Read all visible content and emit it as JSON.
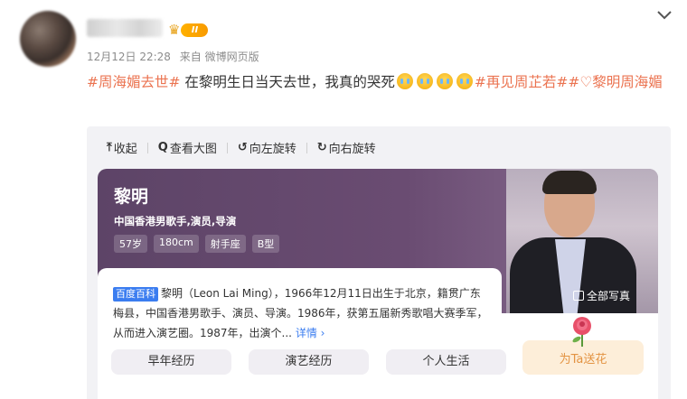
{
  "post": {
    "meta_time": "12月12日 22:28",
    "meta_source": "来自 微博网页版",
    "vip_level": "II",
    "text_parts": {
      "tag1": "#周海媚去世#",
      "body": " 在黎明生日当天去世，我真的哭死",
      "tag2": "#再见周芷若#",
      "tag3": "#♡黎明周海媚"
    }
  },
  "toolbar": {
    "collapse": "收起",
    "view_large": "查看大图",
    "rotate_left": "向左旋转",
    "rotate_right": "向右旋转",
    "collapse_icon": "collapse-icon",
    "zoom_icon": "magnifier-icon",
    "rotate_left_icon": "rotate-left-icon",
    "rotate_right_icon": "rotate-right-icon"
  },
  "baike": {
    "name": "黎明",
    "subtitle": "中国香港男歌手,演员,导演",
    "tags": [
      "57岁",
      "180cm",
      "射手座",
      "B型"
    ],
    "photo_label": "全部写真",
    "source_badge": "百度百科",
    "summary": "黎明（Leon Lai Ming），1966年12月11日出生于北京，籍贯广东梅县，中国香港男歌手、演员、导演。1986年，获第五届新秀歌唱大赛季军，从而进入演艺圈。1987年，出演个...",
    "more": "详情 ›",
    "buttons": [
      "早年经历",
      "演艺经历",
      "个人生活"
    ],
    "flower_btn": "为Ta送花"
  },
  "colors": {
    "hashtag": "#eb7350",
    "hero": "#5d4467",
    "link": "#3b7df0",
    "flower_text": "#e39342"
  }
}
